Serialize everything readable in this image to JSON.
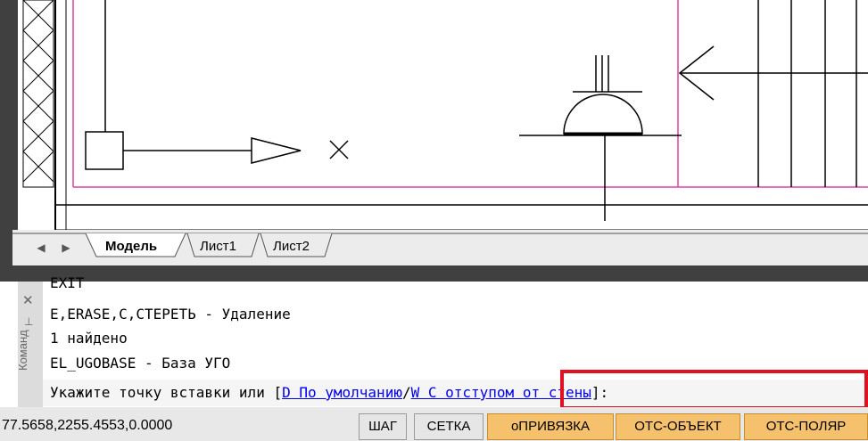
{
  "tabs": {
    "items": [
      {
        "label": "Модель"
      },
      {
        "label": "Лист1"
      },
      {
        "label": "Лист2"
      }
    ]
  },
  "command": {
    "title": "Команд",
    "history": [
      "EXIT",
      "E,ERASE,C,СТЕРЕТЬ - Удаление",
      "1 найдено",
      "EL_UGOBASE - База УГО"
    ],
    "prompt_text": "Укажите точку вставки или [",
    "option_default": "D По умолчанию",
    "option_separator": "/",
    "option_wall": "W С отступом от стены",
    "prompt_end": "]:"
  },
  "status": {
    "coords": "77.5658,2255.4553,0.0000",
    "buttons": [
      {
        "label": "ШАГ",
        "active": false
      },
      {
        "label": "СЕТКА",
        "active": false
      },
      {
        "label": "оПРИВЯЗКА",
        "active": true
      },
      {
        "label": "ОТС-ОБЪЕКТ",
        "active": true
      },
      {
        "label": "ОТС-ПОЛЯР",
        "active": true
      }
    ]
  },
  "colors": {
    "border_pink": "#e040a0",
    "highlight_red": "#e01020",
    "status_on": "#f5c16d"
  }
}
